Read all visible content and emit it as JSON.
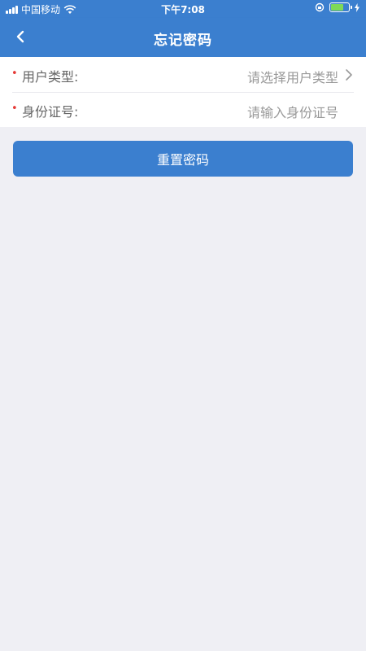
{
  "status_bar": {
    "carrier": "中国移动",
    "time": "下午7:08",
    "battery_level": 0.7
  },
  "nav": {
    "title": "忘记密码"
  },
  "form": {
    "fields": [
      {
        "label": "用户类型:",
        "placeholder": "请选择用户类型",
        "required_mark": "•"
      },
      {
        "label": "身份证号:",
        "placeholder": "请输入身份证号",
        "required_mark": "•"
      }
    ]
  },
  "actions": {
    "reset_label": "重置密码"
  },
  "colors": {
    "primary": "#3b7fcf",
    "background": "#efeff4",
    "required": "#e53935"
  }
}
